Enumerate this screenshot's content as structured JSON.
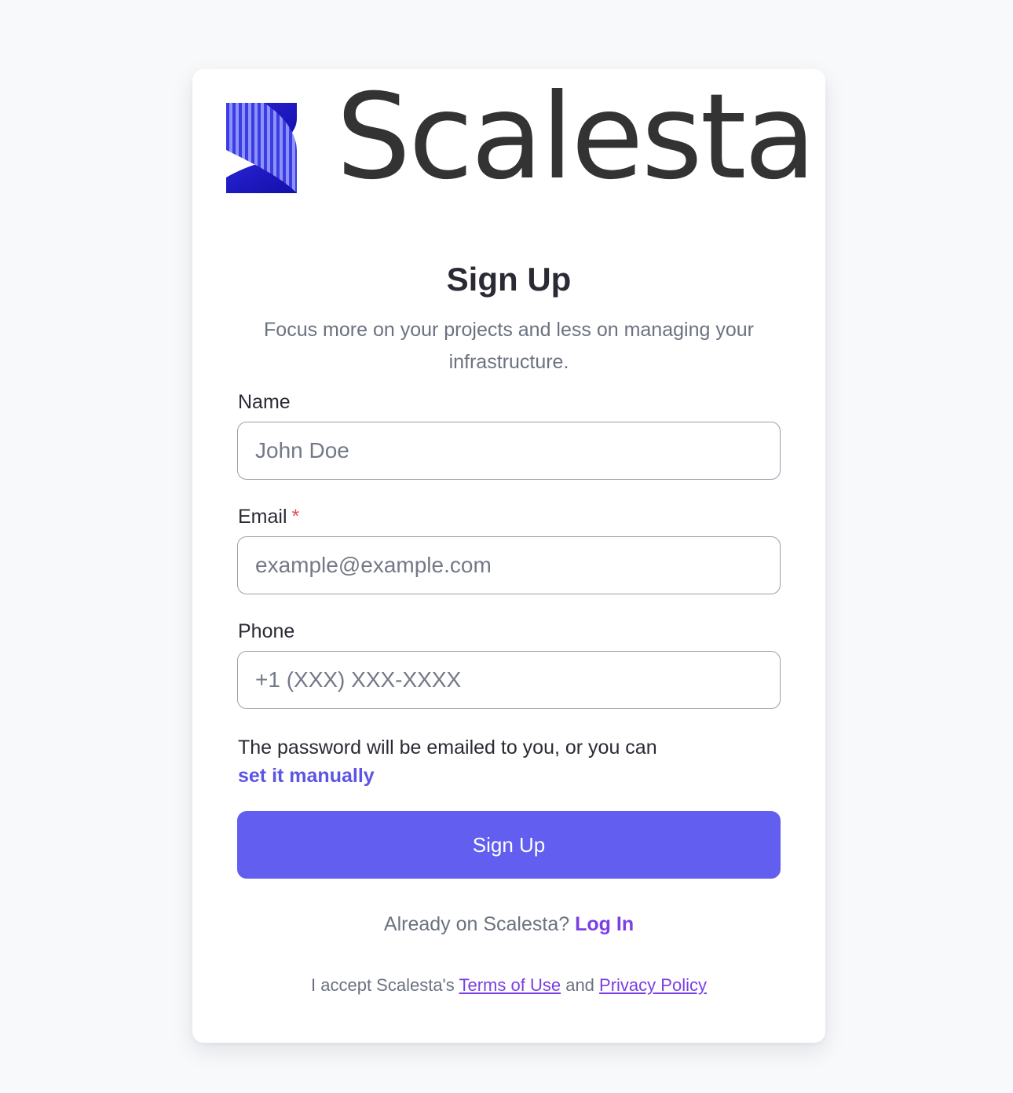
{
  "brand": {
    "name": "Scalesta",
    "logo_icon": "scalesta-s-logo-icon",
    "colors": {
      "logo_dark": "#1a15c8",
      "logo_light": "#6c72f0",
      "wordmark": "#333333"
    }
  },
  "form": {
    "title": "Sign Up",
    "subtitle": "Focus more on your projects and less on managing your infrastructure.",
    "fields": {
      "name": {
        "label": "Name",
        "placeholder": "John Doe",
        "value": ""
      },
      "email": {
        "label": "Email",
        "required_marker": "*",
        "placeholder": "example@example.com",
        "value": ""
      },
      "phone": {
        "label": "Phone",
        "placeholder": "+1 (XXX) XXX-XXXX",
        "value": ""
      }
    },
    "password_note": "The password will be emailed to you, or you can",
    "password_link": "set it manually",
    "submit_label": "Sign Up",
    "accent_color": "#615ef0"
  },
  "login": {
    "prompt": "Already on Scalesta?",
    "link": "Log In"
  },
  "terms": {
    "prefix": "I accept Scalesta's",
    "terms_link": "Terms of Use",
    "conjunction": "and",
    "privacy_link": "Privacy Policy"
  }
}
